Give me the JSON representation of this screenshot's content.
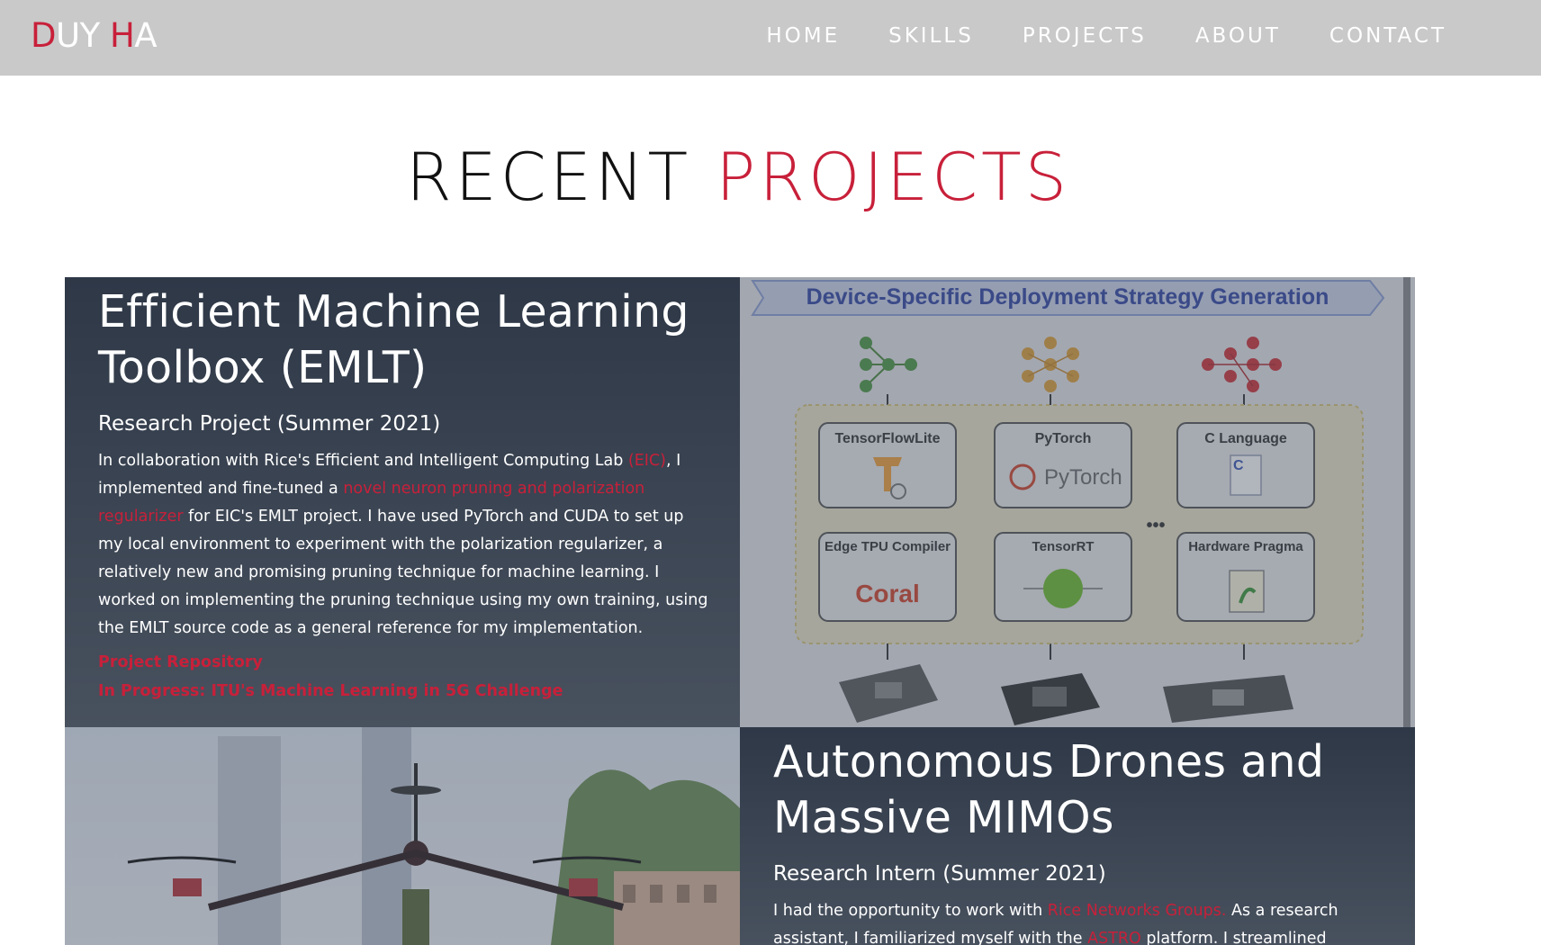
{
  "nav": {
    "logo_part1": "D",
    "logo_part2": "UY ",
    "logo_part3": "H",
    "logo_part4": "A",
    "items": [
      {
        "label": "HOME"
      },
      {
        "label": "SKILLS"
      },
      {
        "label": "PROJECTS"
      },
      {
        "label": "ABOUT"
      },
      {
        "label": "CONTACT"
      }
    ]
  },
  "section": {
    "title_part1": "RECENT ",
    "title_part2": "PROJECTS"
  },
  "projects": [
    {
      "title": "Efficient Machine Learning Toolbox (EMLT)",
      "subtitle": "Research Project (Summer 2021)",
      "desc_1": "In collaboration with Rice's Efficient and Intelligent Computing Lab ",
      "link_eic": "(EIC)",
      "desc_2": ", I implemented and fine-tuned a ",
      "link_regularizer": "novel neuron pruning and polarization regularizer",
      "desc_3": " for EIC's EMLT project. I have used PyTorch and CUDA to set up my local environment to experiment with the polarization regularizer, a relatively new and promising pruning technique for machine learning. I worked on implementing the pruning technique using my own training, using the EMLT source code as a general reference for my implementation.",
      "cta_repo": "Project Repository",
      "cta_challenge": "In Progress: ITU's Machine Learning in 5G Challenge",
      "image": {
        "banner": "Device-Specific Deployment Strategy Generation",
        "frameworks": [
          "TensorFlowLite",
          "PyTorch",
          "C Language"
        ],
        "pytorch_logo": "PyTorch",
        "compilers": [
          "Edge TPU Compiler",
          "TensorRT",
          "Hardware Pragma"
        ],
        "coral_logo": "Coral",
        "ellipsis": "•••",
        "c_glyph": "C"
      }
    },
    {
      "title": "Autonomous Drones and Massive MIMOs",
      "subtitle": "Research Intern (Summer 2021)",
      "desc_1": "I had the opportunity to work with ",
      "link_rice": "Rice Networks Groups.",
      "desc_2": " As a research assistant, I familiarized myself with the ",
      "link_astro": "ASTRO",
      "desc_3": " platform. I streamlined"
    }
  ],
  "colors": {
    "accent": "#c8203a",
    "navbar_bg": "#c9c9c9",
    "card_bg": "#3a4352"
  }
}
